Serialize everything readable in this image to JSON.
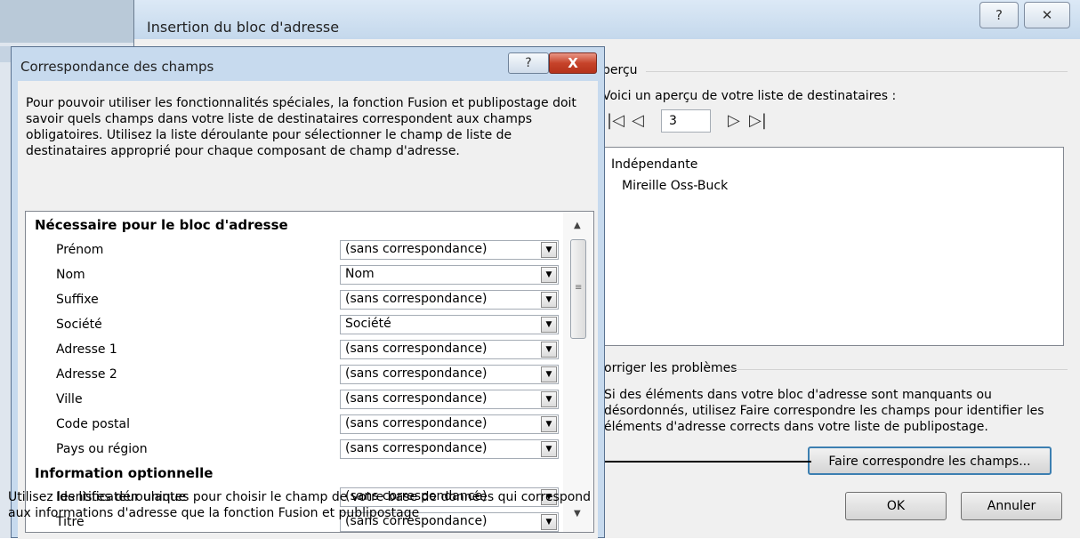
{
  "back_dialog": {
    "title": "Insertion du bloc d'adresse",
    "help": "?",
    "close": "✕",
    "apercu_label": "perçu",
    "apercu_text": "Voici un aperçu de votre liste de destinataires :",
    "nav_first": "|◁",
    "nav_prev": "◁",
    "record_value": "3",
    "nav_next": "▷",
    "nav_last": "▷|",
    "preview_lines": [
      "Indépendante",
      "Mireille Oss-Buck"
    ],
    "corriger_label": "orriger les problèmes",
    "corriger_text": "Si des éléments dans votre bloc d'adresse sont manquants ou désordonnés, utilisez Faire correspondre les champs pour identifier les éléments d'adresse corrects dans votre liste de publipostage.",
    "match_button": "Faire correspondre les champs...",
    "ok_button": "OK",
    "cancel_button": "Annuler"
  },
  "front_dialog": {
    "title": "Correspondance des champs",
    "help": "?",
    "close": "X",
    "intro": "Pour pouvoir utiliser les fonctionnalités spéciales, la fonction Fusion et publipostage doit savoir quels champs dans votre liste de destinataires correspondent aux champs obligatoires. Utilisez la liste déroulante pour sélectionner le champ de liste de destinataires approprié pour chaque composant de champ d'adresse.",
    "section_required": "Nécessaire pour le bloc d'adresse",
    "section_optional": "Information optionnelle",
    "required_fields": [
      {
        "label": "Prénom",
        "value": "(sans correspondance)"
      },
      {
        "label": "Nom",
        "value": "Nom"
      },
      {
        "label": "Suffixe",
        "value": "(sans correspondance)"
      },
      {
        "label": "Société",
        "value": "Société"
      },
      {
        "label": "Adresse 1",
        "value": "(sans correspondance)"
      },
      {
        "label": "Adresse 2",
        "value": "(sans correspondance)"
      },
      {
        "label": "Ville",
        "value": "(sans correspondance)"
      },
      {
        "label": "Code postal",
        "value": "(sans correspondance)"
      },
      {
        "label": "Pays ou région",
        "value": "(sans correspondance)"
      }
    ],
    "optional_fields": [
      {
        "label": "Identificateur unique",
        "value": "(sans correspondance)"
      },
      {
        "label": "Titre",
        "value": "(sans correspondance)"
      }
    ],
    "footer": "Utilisez les listes déroulantes pour choisir le champ de votre base de données qui correspond aux informations d'adresse que la fonction Fusion et publipostage"
  }
}
